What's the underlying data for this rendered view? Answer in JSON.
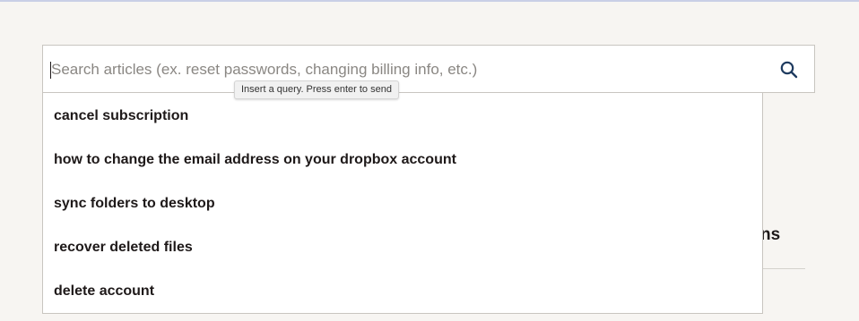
{
  "search": {
    "placeholder": "Search articles (ex. reset passwords, changing billing info, etc.)",
    "value": "",
    "icon": "search-icon",
    "tooltip": "Insert a query. Press enter to send"
  },
  "suggestions": [
    "cancel subscription",
    "how to change the email address on your dropbox account",
    "sync folders to desktop",
    "recover deleted files",
    "delete account"
  ],
  "background": {
    "heading_fragment": "ns"
  },
  "colors": {
    "page_background": "#f7f5f2",
    "text": "#1e1919",
    "search_icon": "#1e3a5f",
    "border": "#c8c5c0"
  }
}
